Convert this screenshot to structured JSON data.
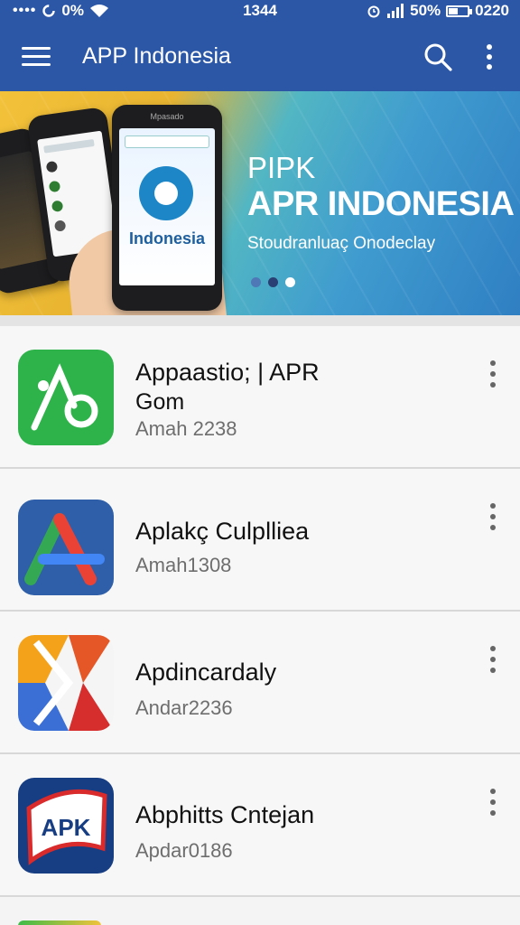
{
  "status_bar": {
    "signal_dots": "••••",
    "data_saver": "0%",
    "time": "1344",
    "battery_percent": "50%",
    "right_time": "0220",
    "battery_level": 0.5
  },
  "app_bar": {
    "title": "APP Indonesia",
    "background_color": "#2c57a6"
  },
  "banner": {
    "line1": "PIPK",
    "line2": "APR INDONESIA",
    "subtitle": "Stoudranluaç Onodeclay",
    "phone_brand": "Indonesia",
    "phone_header": "Mpasado",
    "pager_count": 3,
    "pager_active": 3
  },
  "apps": [
    {
      "name": "Appaastio; | APR",
      "name2": "Gom",
      "sub": "Amah 2238",
      "icon": "green-link-icon"
    },
    {
      "name": "Aplakç Culplliea",
      "name2": "",
      "sub": "Amah1308",
      "icon": "triangle-a-icon"
    },
    {
      "name": "Apdincardaly",
      "name2": "",
      "sub": "Andar2236",
      "icon": "ribbon-k-icon"
    },
    {
      "name": "Abphitts Cntejan",
      "name2": "",
      "sub": "Apdar0186",
      "icon": "apk-badge-icon"
    }
  ]
}
